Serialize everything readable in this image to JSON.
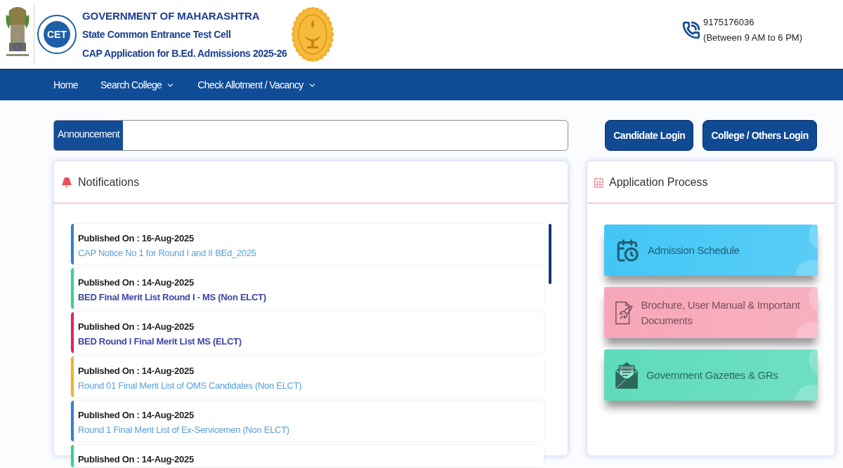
{
  "header": {
    "logo_text": "CET",
    "title": "GOVERNMENT OF MAHARASHTRA",
    "subtitle": "State Common Entrance Test Cell",
    "tagline": "CAP Application for B.Ed. Admissions 2025-26",
    "helpline": {
      "phone": "9175176036",
      "hours": "(Between 9 AM to 6 PM)"
    }
  },
  "nav": [
    {
      "label": "Home",
      "dropdown": false
    },
    {
      "label": "Search College",
      "dropdown": true
    },
    {
      "label": "Check Allotment / Vacancy",
      "dropdown": true
    }
  ],
  "announcement": {
    "label": "Announcement"
  },
  "login_buttons": [
    "Candidate Login",
    "College / Others Login"
  ],
  "notifications": {
    "title": "Notifications",
    "items": [
      {
        "published": "Published On : 16-Aug-2025",
        "link": "CAP Notice No 1 for Round I and II BEd_2025",
        "color": "#2f80d8",
        "highlighted": false
      },
      {
        "published": "Published On : 14-Aug-2025",
        "link": "BED Final Merit List Round I - MS (Non ELCT)",
        "color": "#2fd68c",
        "highlighted": true
      },
      {
        "published": "Published On : 14-Aug-2025",
        "link": "BED Round I Final Merit List MS (ELCT)",
        "color": "#e0245e",
        "highlighted": true
      },
      {
        "published": "Published On : 14-Aug-2025",
        "link": "Round 01 Final Merit List of OMS Candidates (Non ELCT)",
        "color": "#f0b429",
        "highlighted": false
      },
      {
        "published": "Published On : 14-Aug-2025",
        "link": "Round 1 Final Merit List of Ex-Servicemen (Non ELCT)",
        "color": "#2f80d8",
        "highlighted": false
      },
      {
        "published": "Published On : 14-Aug-2025",
        "color": "#2fd68c"
      }
    ]
  },
  "application_process": {
    "title": "Application Process",
    "tiles": [
      {
        "kind": "schedule",
        "label": "Admission Schedule",
        "color": "#42c6f5"
      },
      {
        "kind": "documents",
        "label": "Brochure, User Manual & Important Documents",
        "color": "#f7a6b9"
      },
      {
        "kind": "gazette",
        "label": "Government Gazettes & GRs",
        "color": "#5ddbbb"
      }
    ]
  }
}
